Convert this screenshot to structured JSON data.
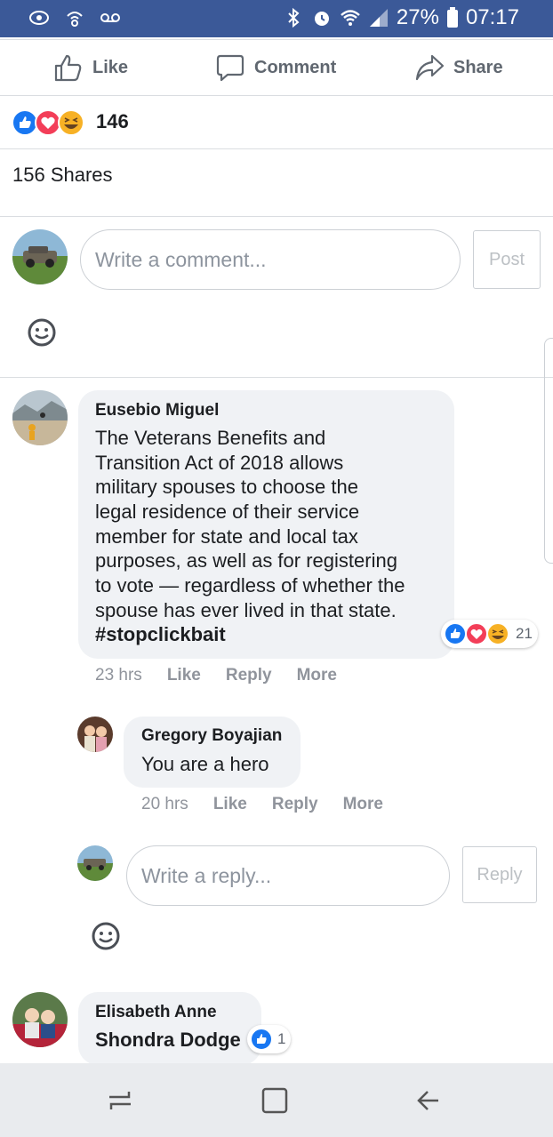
{
  "status_bar": {
    "battery": "27%",
    "time": "07:17",
    "color": "#3b5998"
  },
  "actions": {
    "like": "Like",
    "comment": "Comment",
    "share": "Share"
  },
  "post": {
    "reaction_count": "146",
    "shares": "156 Shares"
  },
  "composer": {
    "placeholder": "Write a comment...",
    "post_label": "Post"
  },
  "comments": [
    {
      "author": "Eusebio Miguel",
      "lines": [
        "The Veterans Benefits and",
        "Transition Act of 2018 allows",
        "military spouses to choose the",
        "legal residence of their service",
        "member for state and local tax",
        "purposes, as well as for registering",
        "to vote — regardless of whether the",
        "spouse has ever lived in that state."
      ],
      "hashtag": "#stopclickbait",
      "reactions": "21",
      "time": "23 hrs",
      "like": "Like",
      "reply": "Reply",
      "more": "More"
    },
    {
      "author": "Elisabeth Anne",
      "text": "Shondra Dodge",
      "reactions": "1"
    }
  ],
  "reply": {
    "author": "Gregory Boyajian",
    "text": "You are a hero",
    "time": "20 hrs",
    "like": "Like",
    "reply": "Reply",
    "more": "More"
  },
  "reply_composer": {
    "placeholder": "Write a reply...",
    "button": "Reply"
  },
  "icons": {
    "like": "thumbs-up-icon",
    "comment": "speech-bubble-icon",
    "share": "share-arrow-icon",
    "emoji": "smiley-icon",
    "nav": [
      "recent-apps-icon",
      "home-icon",
      "back-icon"
    ]
  }
}
